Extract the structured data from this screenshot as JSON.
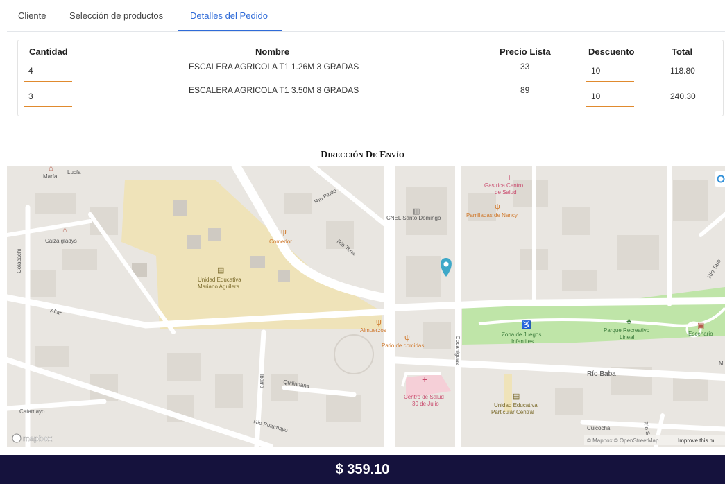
{
  "tabs": [
    {
      "label": "Cliente"
    },
    {
      "label": "Selección de productos"
    },
    {
      "label": "Detalles del Pedido"
    }
  ],
  "table": {
    "headers": [
      "Cantidad",
      "Nombre",
      "Precio Lista",
      "Descuento",
      "Total"
    ],
    "rows": [
      {
        "cantidad": "4",
        "nombre": "ESCALERA AGRICOLA T1 1.26M 3 GRADAS",
        "precio": "33",
        "descuento": "10",
        "total": "118.80"
      },
      {
        "cantidad": "3",
        "nombre": "ESCALERA AGRICOLA T1 3.50M 8 GRADAS",
        "precio": "89",
        "descuento": "10",
        "total": "240.30"
      }
    ]
  },
  "shipping": {
    "title": "Dirección De Envío"
  },
  "map": {
    "labels": {
      "maria": "María",
      "lucia": "Lucía",
      "rio_pindo": "Río Pindo",
      "cnel": "CNEL Santo Domingo",
      "gastrica": "Gastrica Centro",
      "gastrica2": "de Salud",
      "parrilladas": "Parrilladas de Nancy",
      "caiza": "Caiza gladys",
      "comedor": "Comedor",
      "rio_tena": "Río Tena",
      "colacachi": "Colacachi",
      "ue_mariano1": "Unidad Educativa",
      "ue_mariano2": "Mariano Aguilera",
      "altar": "Altar",
      "almuerzos": "Almuerzos",
      "patio": "Patio de comidas",
      "cocaniguas": "Cocaniguas",
      "zona1": "Zona de Juegos",
      "zona2": "Infantiles",
      "parque1": "Parque Recreativo",
      "parque2": "Lineal",
      "escenario": "Escenario",
      "rio_baba": "Río Baba",
      "ibarra": "Ibarra",
      "quilindana": "Quilindana",
      "centro1": "Centro de Salud",
      "centro2": "30 de Julio",
      "ue_central1": "Unidad Educativa",
      "ue_central2": "Particular Central",
      "catamayo": "Catamayo",
      "rio_putumayo": "Río Putumayo",
      "cuicocha": "Cuicocha",
      "rio_taro": "Río Taro",
      "rio_s": "Río S",
      "m": "M"
    },
    "brand": "mapbox",
    "attribution": "© Mapbox © OpenStreetMap",
    "improve": "Improve this m"
  },
  "summary": {
    "total": "$ 359.10"
  },
  "colors": {
    "accent": "#2f6bd8",
    "underline": "#e08a2e",
    "footer": "#15123d",
    "marker": "#3ea8c8",
    "park": "#bfe5a8",
    "school": "#efe3b9"
  }
}
